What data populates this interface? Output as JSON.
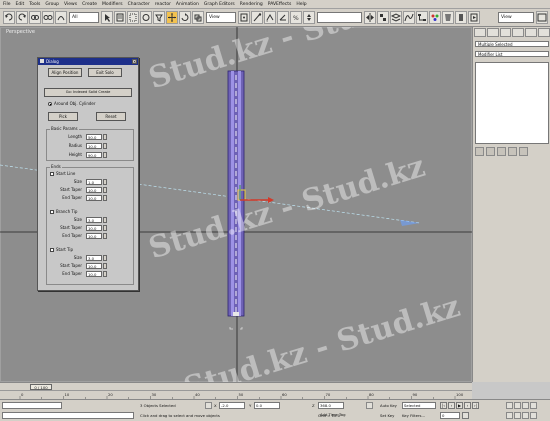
{
  "menu": [
    "File",
    "Edit",
    "Tools",
    "Group",
    "Views",
    "Create",
    "Modifiers",
    "Character",
    "reactor",
    "Animation",
    "Graph Editors",
    "Rendering",
    "PAVEffects",
    "Help"
  ],
  "toolbar": {
    "selection_filter": "All",
    "coord_system": "View",
    "named_selection": "",
    "render_type": "View"
  },
  "viewport": {
    "label": "Perspective"
  },
  "dialog": {
    "title": "Dialog",
    "tab1": "Align Position",
    "tab2": "Exit Solo",
    "button_top": "Go: Indexed Solid Create",
    "radio_label": "Around Obj.  Cylinder",
    "btn_left": "Pick",
    "btn_right": "Reset",
    "group_basic": "Basic Params",
    "basic": [
      {
        "label": "Length",
        "value": "50.0"
      },
      {
        "label": "Radius",
        "value": "10.0"
      },
      {
        "label": "Height",
        "value": "90.0"
      }
    ],
    "group_ends": "Ends",
    "sections": [
      {
        "label": "Start Line",
        "rows": [
          {
            "label": "Size",
            "value": "1.0"
          },
          {
            "label": "Start Taper",
            "value": "10.0"
          },
          {
            "label": "End Taper",
            "value": "10.0"
          }
        ]
      },
      {
        "label": "Branch Tip",
        "rows": [
          {
            "label": "Size",
            "value": "3.0"
          },
          {
            "label": "Start Taper",
            "value": "10.0"
          },
          {
            "label": "End Taper",
            "value": "10.0"
          }
        ]
      },
      {
        "label": "Start Tip",
        "rows": [
          {
            "label": "Size",
            "value": "3.0"
          },
          {
            "label": "Start Taper",
            "value": "10.0"
          },
          {
            "label": "End Taper",
            "value": "10.0"
          }
        ]
      }
    ]
  },
  "command_panel": {
    "field1": "Multiple Selected",
    "field2": "Modifier List"
  },
  "timeline": {
    "frame": "0 / 100",
    "ticks": [
      "0",
      "10",
      "20",
      "30",
      "40",
      "50",
      "60",
      "70",
      "80",
      "90",
      "100"
    ]
  },
  "status": {
    "selection": "3 Objects Selected",
    "prompt": "Click and drag to select and move objects",
    "x_label": "X",
    "x_value": "-2.0",
    "y_label": "Y",
    "y_value": "0.0",
    "z_label": "Z",
    "z_value": "368.0",
    "grid": "Grid = 10.0",
    "add_time_tag": "Add Time Tag",
    "autokey": "Auto Key",
    "autokey_value": "Selected",
    "setkey": "Set Key",
    "key_filters": "Key Filters...",
    "frame_field": "0"
  },
  "watermark": "Stud.kz - Stud.kz"
}
